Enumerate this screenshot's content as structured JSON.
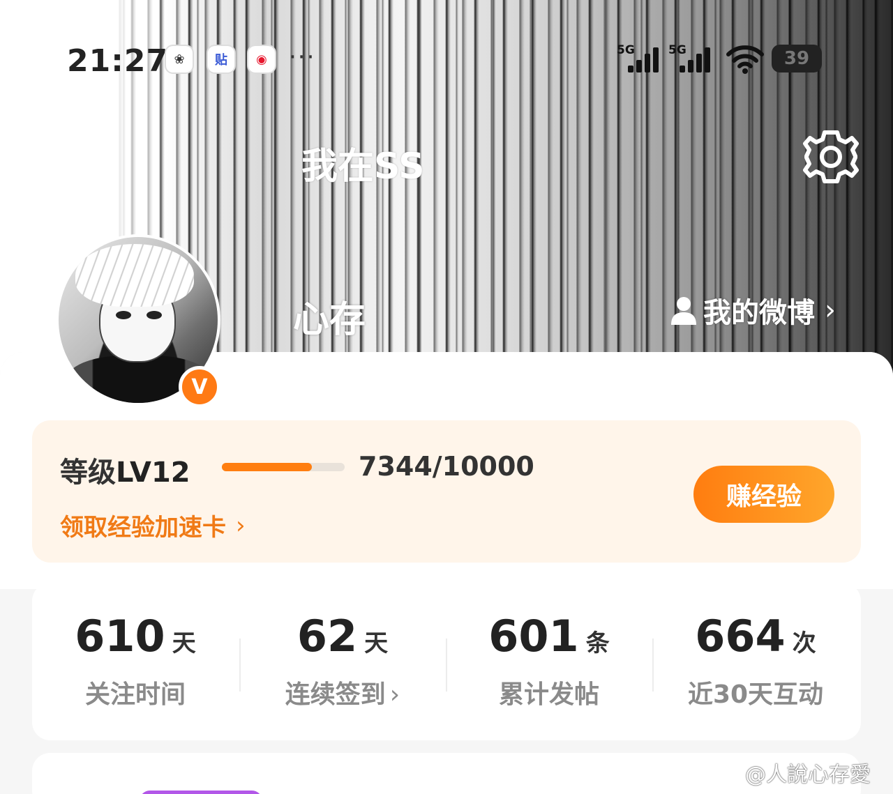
{
  "status_bar": {
    "time": "21:27",
    "apps": [
      {
        "icon": "flower-app-icon",
        "glyph": "❀"
      },
      {
        "icon": "tieba-app-icon",
        "glyph": "贴"
      },
      {
        "icon": "weibo-app-icon",
        "glyph": "◉"
      }
    ],
    "more": "···",
    "signals": [
      "5G",
      "5G"
    ],
    "battery": "39"
  },
  "banner": {
    "title": "我在SS",
    "user_name": "心存",
    "my_weibo": "我的微博",
    "settings_icon": "gear-icon"
  },
  "profile": {
    "vip_badge": "V"
  },
  "level": {
    "label_prefix": "等级",
    "level": "LV12",
    "exp": "7344/10000",
    "progress": 0.7344,
    "boost_link": "领取经验加速卡",
    "earn_button": "赚经验",
    "accent": "#ff7e10"
  },
  "stats": [
    {
      "value": "610",
      "unit": "天",
      "label": "关注时间",
      "chevron": ""
    },
    {
      "value": "62",
      "unit": "天",
      "label": "连续签到",
      "chevron": "›"
    },
    {
      "value": "601",
      "unit": "条",
      "label": "累计发帖",
      "chevron": ""
    },
    {
      "value": "664",
      "unit": "次",
      "label": "近30天互动",
      "chevron": ""
    }
  ],
  "watermark": "@人說心存愛"
}
